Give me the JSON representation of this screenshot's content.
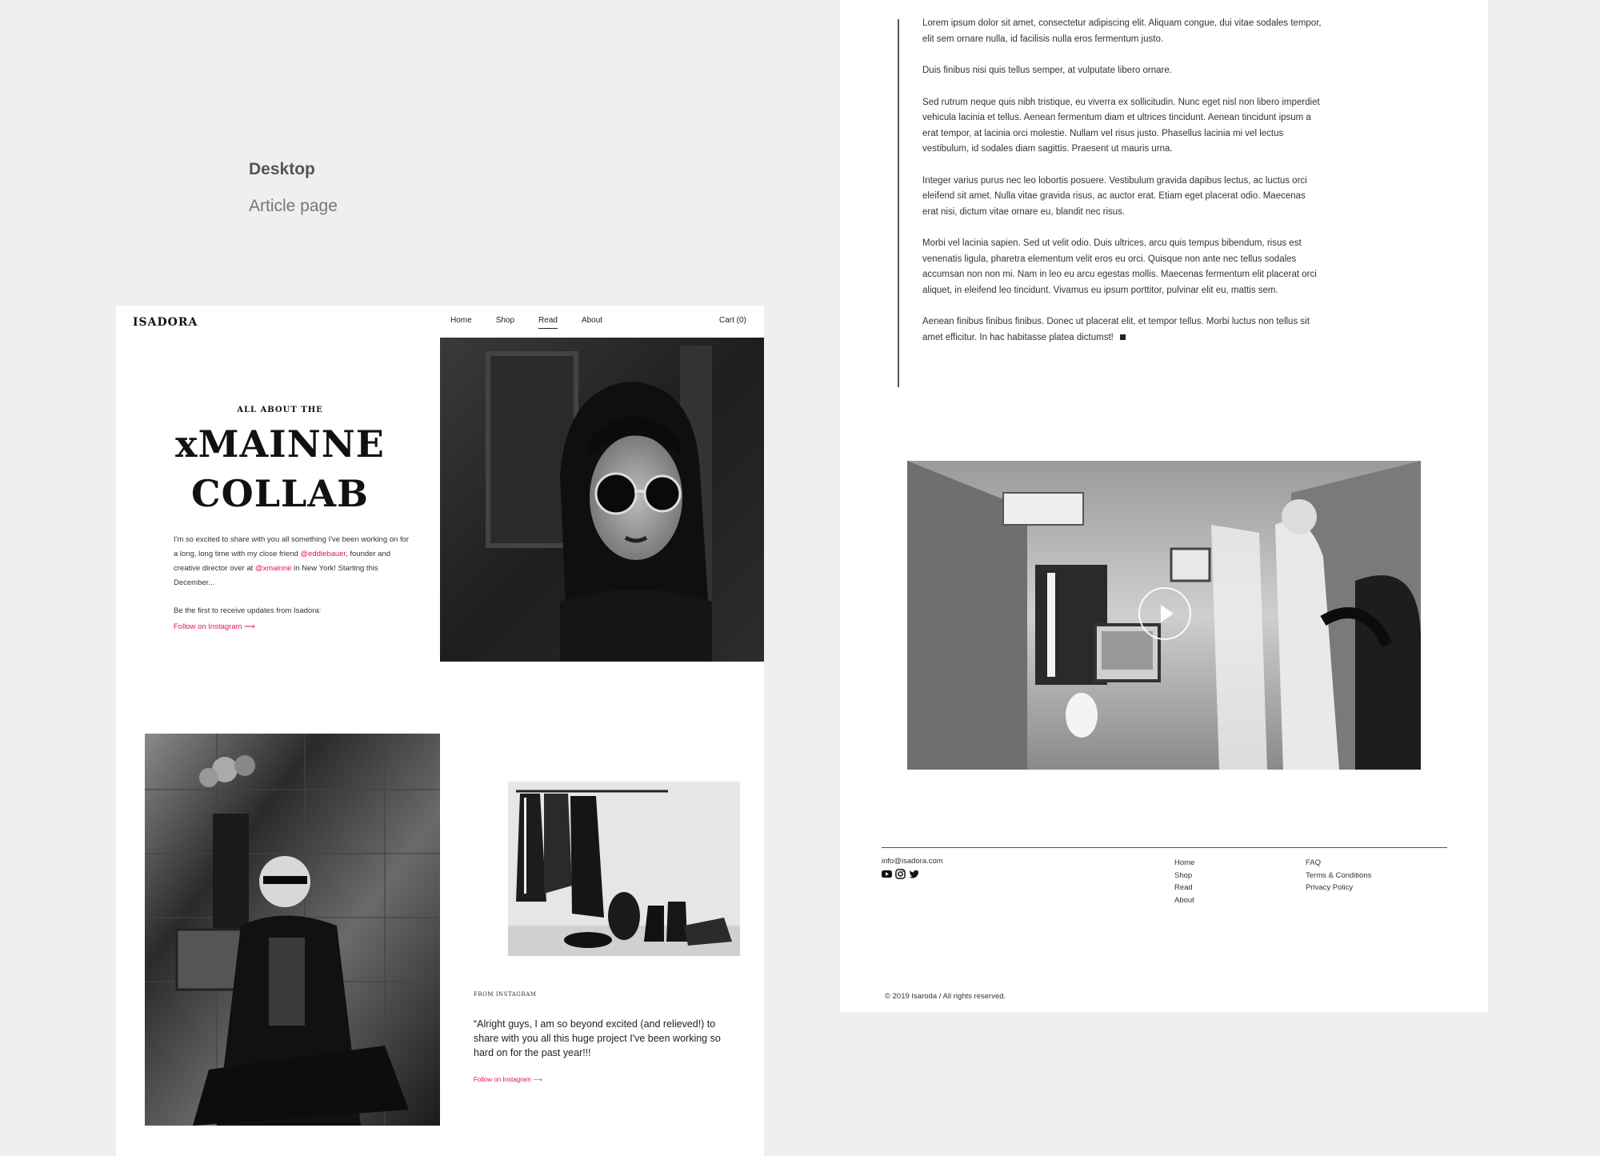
{
  "presentation": {
    "label": "Desktop",
    "sublabel": "Article page"
  },
  "header": {
    "logo": "ISADORA",
    "nav": [
      {
        "label": "Home",
        "active": false
      },
      {
        "label": "Shop",
        "active": false
      },
      {
        "label": "Read",
        "active": true
      },
      {
        "label": "About",
        "active": false
      }
    ],
    "cart": "Cart (0)"
  },
  "hero": {
    "kicker": "ALL ABOUT THE",
    "title_line1": "xMAINNE",
    "title_line2": "COLLAB",
    "intro_part1": "I'm so excited to share with you all something I've been working on for a long, long time with my close friend ",
    "handle1": "@eddiebauer",
    "intro_part2": ", founder and creative director over at ",
    "handle2": "@xmainne",
    "intro_part3": " in New York! Starting this December...",
    "updates_text": "Be the first to receive updates from Isadora:",
    "follow_link": "Follow on Instagram ⟶"
  },
  "instagram": {
    "kicker": "FROM INSTAGRAM",
    "quote": "“Alright guys, I am so beyond excited (and relieved!) to share with you all this huge project I've been working so hard on for the past year!!!",
    "follow_link": "Follow on Instagram ⟶"
  },
  "article": {
    "paragraphs": [
      "Lorem ipsum dolor sit amet, consectetur adipiscing elit. Aliquam congue, dui vitae sodales tempor, elit sem ornare nulla, id facilisis nulla eros fermentum justo.",
      "Duis finibus nisi quis tellus semper, at vulputate libero ornare.",
      "Sed rutrum neque quis nibh tristique, eu viverra ex sollicitudin. Nunc eget nisl non libero imperdiet vehicula lacinia et tellus. Aenean fermentum diam et ultrices tincidunt. Aenean tincidunt ipsum a erat tempor, at lacinia orci molestie. Nullam vel risus justo. Phasellus lacinia mi vel lectus vestibulum, id sodales diam sagittis. Praesent ut mauris urna.",
      "Integer varius purus nec leo lobortis posuere. Vestibulum gravida dapibus lectus, ac luctus orci eleifend sit amet. Nulla vitae gravida risus, ac auctor erat. Etiam eget placerat odio. Maecenas erat nisi, dictum vitae ornare eu, blandit nec risus.",
      "Morbi vel lacinia sapien. Sed ut velit odio. Duis ultrices, arcu quis tempus bibendum, risus est venenatis ligula, pharetra elementum velit eros eu orci. Quisque non ante nec tellus sodales accumsan non non mi. Nam in leo eu arcu egestas mollis. Maecenas fermentum elit placerat orci aliquet, in eleifend leo tincidunt. Vivamus eu ipsum porttitor, pulvinar elit eu, mattis sem.",
      "Aenean finibus finibus finibus. Donec ut placerat elit, et tempor tellus. Morbi luctus non tellus sit amet efficitur. In hac habitasse platea dictumst!"
    ]
  },
  "footer": {
    "email": "info@isadora.com",
    "socials": [
      "youtube-icon",
      "instagram-icon",
      "twitter-icon"
    ],
    "col1": [
      "Home",
      "Shop",
      "Read",
      "About"
    ],
    "col2": [
      "FAQ",
      "Terms & Conditions",
      "Privacy Policy"
    ],
    "copyright": "© 2019 Isaroda / All rights reserved."
  },
  "colors": {
    "accent": "#e4135c",
    "page_bg": "#efefef"
  }
}
